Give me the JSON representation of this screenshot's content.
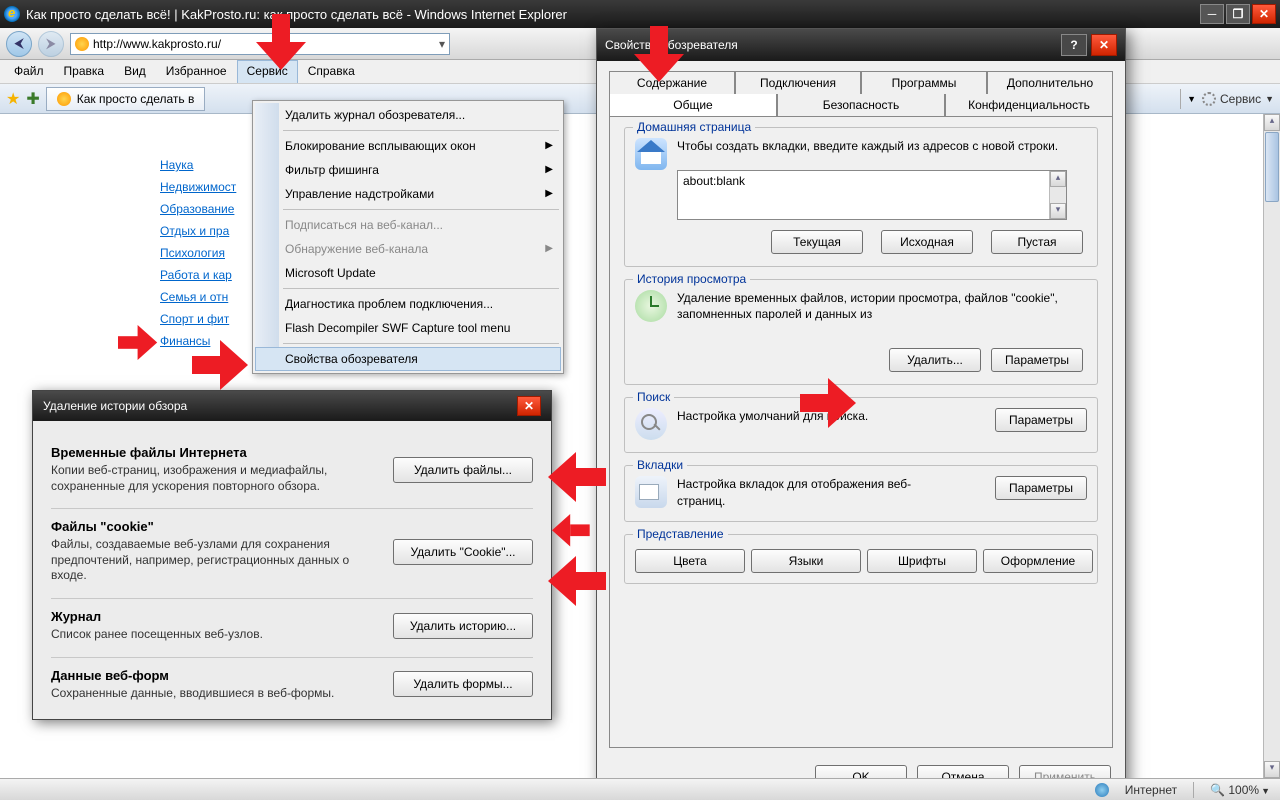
{
  "window": {
    "title": "Как просто сделать всё! | KakProsto.ru: как просто сделать всё - Windows Internet Explorer",
    "url": "http://www.kakprosto.ru/"
  },
  "menubar": [
    "Файл",
    "Правка",
    "Вид",
    "Избранное",
    "Сервис",
    "Справка"
  ],
  "tab_label": "Как просто сделать в",
  "service_tool": "Сервис",
  "sidebar_links": [
    "Наука",
    "Недвижимост",
    "Образование",
    "Отдых и пра",
    "Психология",
    "Работа и кар",
    "Семья и отн",
    "Спорт и фит",
    "Финансы"
  ],
  "service_menu": {
    "items": [
      {
        "label": "Удалить журнал обозревателя...",
        "type": "item"
      },
      {
        "type": "sep"
      },
      {
        "label": "Блокирование всплывающих окон",
        "type": "sub"
      },
      {
        "label": "Фильтр фишинга",
        "type": "sub"
      },
      {
        "label": "Управление надстройками",
        "type": "sub"
      },
      {
        "type": "sep"
      },
      {
        "label": "Подписаться на веб-канал...",
        "type": "disabled"
      },
      {
        "label": "Обнаружение веб-канала",
        "type": "disabled-sub"
      },
      {
        "label": "Microsoft Update",
        "type": "item"
      },
      {
        "type": "sep"
      },
      {
        "label": "Диагностика проблем подключения...",
        "type": "item"
      },
      {
        "label": "Flash Decompiler SWF Capture tool menu",
        "type": "item"
      },
      {
        "type": "sep"
      },
      {
        "label": "Свойства обозревателя",
        "type": "highlight"
      }
    ]
  },
  "io_dialog": {
    "title": "Свойства обозревателя",
    "tabs_row1": [
      "Содержание",
      "Подключения",
      "Программы",
      "Дополнительно"
    ],
    "tabs_row2": [
      "Общие",
      "Безопасность",
      "Конфиденциальность"
    ],
    "active_tab": "Общие",
    "home": {
      "legend": "Домашняя страница",
      "text": "Чтобы создать вкладки, введите каждый из адресов с новой строки.",
      "value": "about:blank",
      "btns": [
        "Текущая",
        "Исходная",
        "Пустая"
      ]
    },
    "history": {
      "legend": "История просмотра",
      "text": "Удаление временных файлов, истории просмотра, файлов \"cookie\", запомненных паролей и данных из",
      "btns": [
        "Удалить...",
        "Параметры"
      ]
    },
    "search": {
      "legend": "Поиск",
      "text": "Настройка умолчаний для поиска.",
      "btn": "Параметры"
    },
    "tabs_group": {
      "legend": "Вкладки",
      "text": "Настройка вкладок для отображения веб-страниц.",
      "btn": "Параметры"
    },
    "appearance": {
      "legend": "Представление",
      "btns": [
        "Цвета",
        "Языки",
        "Шрифты",
        "Оформление"
      ]
    },
    "dlg_btns": [
      "OK",
      "Отмена",
      "Применить"
    ]
  },
  "del_dialog": {
    "title": "Удаление истории обзора",
    "sections": [
      {
        "h": "Временные файлы Интернета",
        "p": "Копии веб-страниц, изображения и медиафайлы, сохраненные для ускорения повторного обзора.",
        "btn": "Удалить файлы..."
      },
      {
        "h": "Файлы \"cookie\"",
        "p": "Файлы, создаваемые веб-узлами для сохранения предпочтений, например, регистрационных данных о входе.",
        "btn": "Удалить \"Cookie\"..."
      },
      {
        "h": "Журнал",
        "p": "Список ранее посещенных веб-узлов.",
        "btn": "Удалить историю..."
      },
      {
        "h": "Данные веб-форм",
        "p": "Сохраненные данные, вводившиеся в веб-формы.",
        "btn": "Удалить формы..."
      }
    ]
  },
  "status": {
    "zone": "Интернет",
    "zoom": "100%"
  }
}
